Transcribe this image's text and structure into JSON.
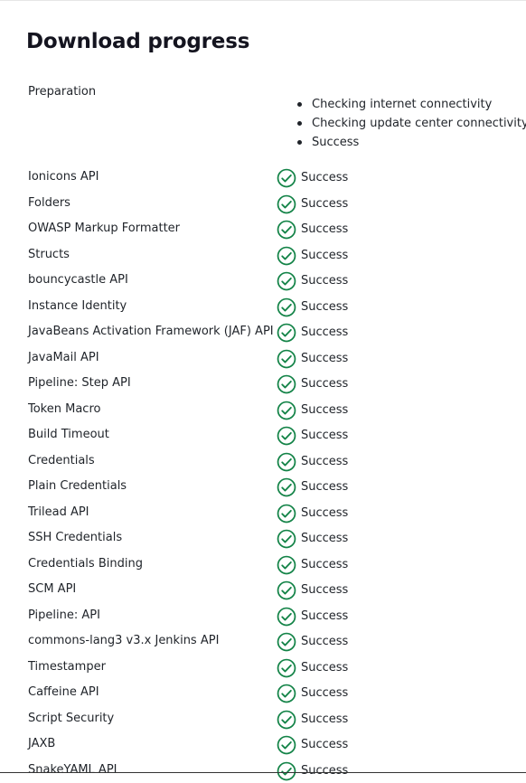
{
  "page": {
    "title": "Download progress"
  },
  "preparation": {
    "label": "Preparation",
    "steps": [
      "Checking internet connectivity",
      "Checking update center connectivity",
      "Success"
    ]
  },
  "status_icon": "check-circle-icon",
  "colors": {
    "success_green": "#138347",
    "text": "#1f2329"
  },
  "plugins": [
    {
      "name": "Ionicons API",
      "status": "Success"
    },
    {
      "name": "Folders",
      "status": "Success"
    },
    {
      "name": "OWASP Markup Formatter",
      "status": "Success"
    },
    {
      "name": "Structs",
      "status": "Success"
    },
    {
      "name": "bouncycastle API",
      "status": "Success"
    },
    {
      "name": "Instance Identity",
      "status": "Success"
    },
    {
      "name": "JavaBeans Activation Framework (JAF) API",
      "status": "Success"
    },
    {
      "name": "JavaMail API",
      "status": "Success"
    },
    {
      "name": "Pipeline: Step API",
      "status": "Success"
    },
    {
      "name": "Token Macro",
      "status": "Success"
    },
    {
      "name": "Build Timeout",
      "status": "Success"
    },
    {
      "name": "Credentials",
      "status": "Success"
    },
    {
      "name": "Plain Credentials",
      "status": "Success"
    },
    {
      "name": "Trilead API",
      "status": "Success"
    },
    {
      "name": "SSH Credentials",
      "status": "Success"
    },
    {
      "name": "Credentials Binding",
      "status": "Success"
    },
    {
      "name": "SCM API",
      "status": "Success"
    },
    {
      "name": "Pipeline: API",
      "status": "Success"
    },
    {
      "name": "commons-lang3 v3.x Jenkins API",
      "status": "Success"
    },
    {
      "name": "Timestamper",
      "status": "Success"
    },
    {
      "name": "Caffeine API",
      "status": "Success"
    },
    {
      "name": "Script Security",
      "status": "Success"
    },
    {
      "name": "JAXB",
      "status": "Success"
    },
    {
      "name": "SnakeYAML API",
      "status": "Success"
    }
  ]
}
